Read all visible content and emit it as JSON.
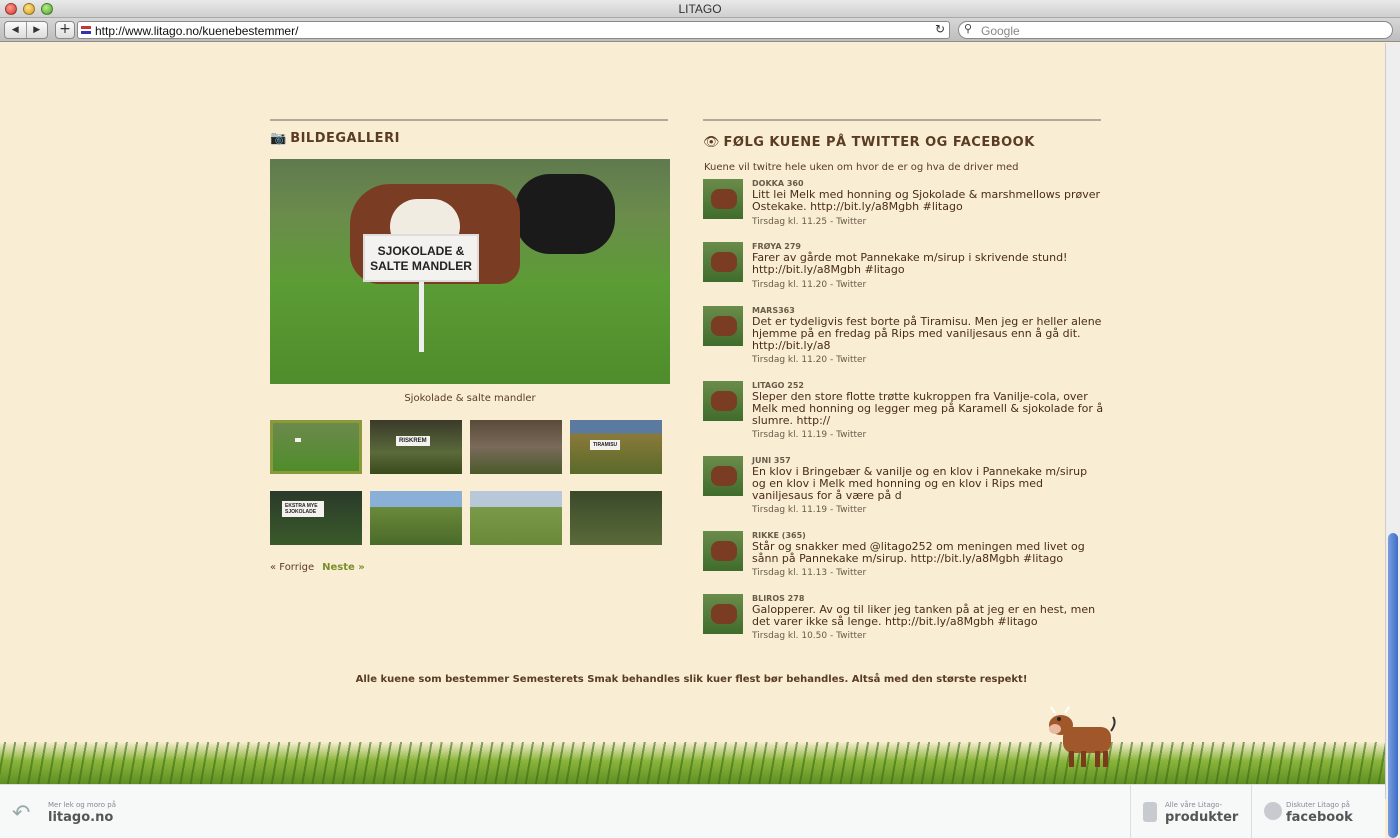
{
  "browser": {
    "title": "LITAGO",
    "back_glyph": "◀",
    "forward_glyph": "▶",
    "add_glyph": "+",
    "url": "http://www.litago.no/kuenebestemmer/",
    "reload_glyph": "↻",
    "search_placeholder": "Google"
  },
  "gallery": {
    "heading": "BILDEGALLERI",
    "main_sign": "SJOKOLADE & SALTE MANDLER",
    "caption": "Sjokolade & salte mandler",
    "thumbs": [
      {
        "label": "",
        "selected": true
      },
      {
        "label": "RISKREM"
      },
      {
        "label": ""
      },
      {
        "label": "TIRAMISU"
      },
      {
        "label": "EKSTRA MYE SJOKOLADE"
      },
      {
        "label": ""
      },
      {
        "label": ""
      },
      {
        "label": ""
      }
    ],
    "prev": "« Forrige",
    "next": "Neste »"
  },
  "social": {
    "heading": "FØLG KUENE PÅ TWITTER OG FACEBOOK",
    "intro": "Kuene vil twitre hele uken om hvor de er og hva de driver med",
    "tweets": [
      {
        "who": "DOKKA 360",
        "msg": "Litt lei Melk med honning og Sjokolade & marshmellows prøver Ostekake. http://bit.ly/a8Mgbh #litago",
        "meta": "Tirsdag kl. 11.25 - Twitter"
      },
      {
        "who": "FRØYA 279",
        "msg": "Farer av gårde mot Pannekake m/sirup i skrivende stund! http://bit.ly/a8Mgbh #litago",
        "meta": "Tirsdag kl. 11.20 - Twitter"
      },
      {
        "who": "MARS363",
        "msg": "Det er tydeligvis fest borte på Tiramisu. Men jeg er heller alene hjemme på en fredag på Rips med vaniljesaus enn å gå dit. http://bit.ly/a8",
        "meta": "Tirsdag kl. 11.20 - Twitter"
      },
      {
        "who": "LITAGO 252",
        "msg": "Sleper den store flotte trøtte kukroppen fra Vanilje-cola, over Melk med honning og legger meg på Karamell & sjokolade for å slumre. http://",
        "meta": "Tirsdag kl. 11.19 - Twitter"
      },
      {
        "who": "JUNI 357",
        "msg": "En klov i Bringebær & vanilje og en klov i Pannekake m/sirup og en klov i Melk med honning og en klov i Rips med vaniljesaus for å være på d",
        "meta": "Tirsdag kl. 11.19 - Twitter"
      },
      {
        "who": "RIKKE (365)",
        "msg": "Står og snakker med @litago252 om meningen med livet og sånn på Pannekake m/sirup. http://bit.ly/a8Mgbh #litago",
        "meta": "Tirsdag kl. 11.13 - Twitter"
      },
      {
        "who": "BLIROS 278",
        "msg": "Galopperer. Av og til liker jeg tanken på at jeg er en hest, men det varer ikke så lenge. http://bit.ly/a8Mgbh #litago",
        "meta": "Tirsdag kl. 10.50 - Twitter"
      }
    ]
  },
  "footer_note": "Alle kuene som bestemmer Semesterets Smak behandles slik kuer flest bør behandles. Altså med den største respekt!",
  "bottombar": {
    "left_small": "Mer lek og moro på",
    "left_big": "litago.no",
    "products_small": "Alle våre Litago-",
    "products_big": "produkter",
    "facebook_small": "Diskuter Litago på",
    "facebook_big": "facebook"
  }
}
